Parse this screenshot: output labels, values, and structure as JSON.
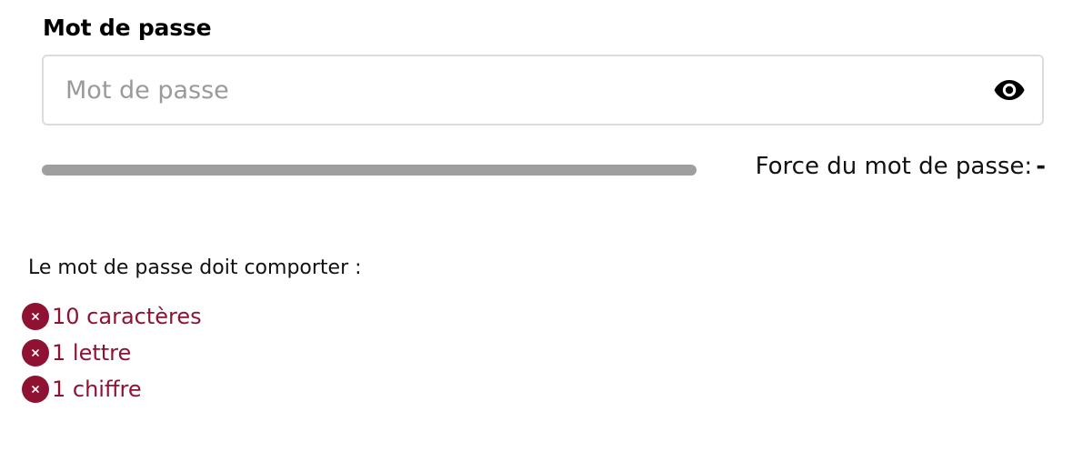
{
  "password_field": {
    "label": "Mot de passe",
    "placeholder": "Mot de passe",
    "value": ""
  },
  "visibility_toggle": {
    "icon": "eye-icon"
  },
  "strength": {
    "label": "Force du mot de passe:",
    "value": "-",
    "level": 0
  },
  "requirements": {
    "title": "Le mot de passe doit comporter :",
    "items": [
      {
        "label": "10 caractères",
        "met": false,
        "icon": "x-circle-icon"
      },
      {
        "label": "1 lettre",
        "met": false,
        "icon": "x-circle-icon"
      },
      {
        "label": "1 chiffre",
        "met": false,
        "icon": "x-circle-icon"
      }
    ]
  },
  "colors": {
    "error": "#8f1233",
    "track": "#9f9f9f",
    "border": "#dcdcdc",
    "placeholder": "#9a9a9a"
  }
}
